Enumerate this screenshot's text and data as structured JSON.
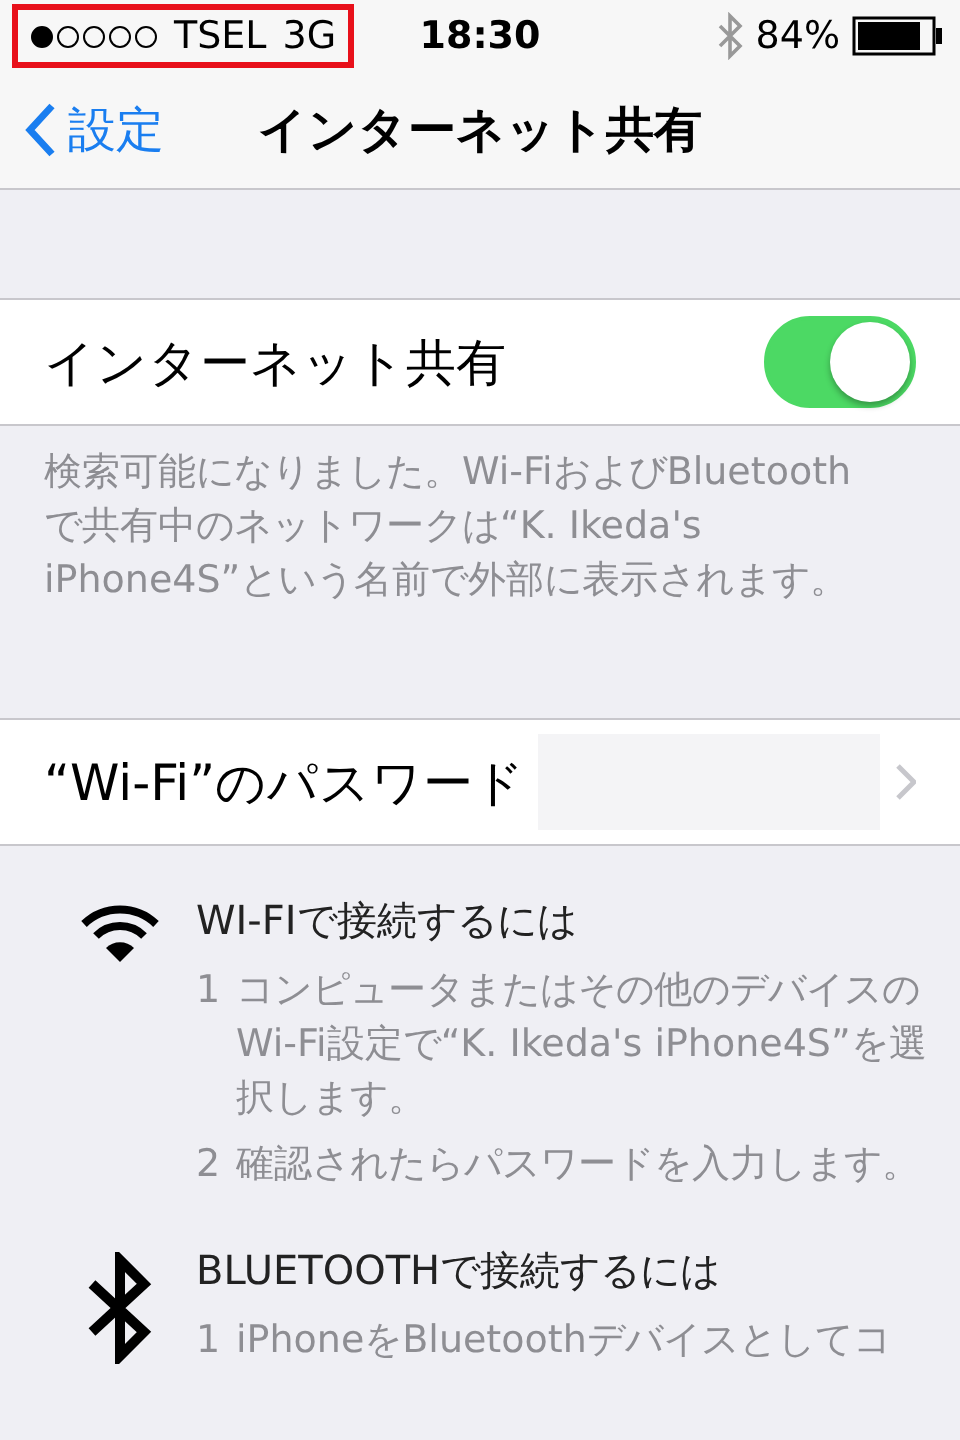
{
  "status_bar": {
    "carrier": "TSEL",
    "network": "3G",
    "carrier_highlighted": true,
    "time": "18:30",
    "battery": "84%"
  },
  "nav": {
    "back_label": "設定",
    "title": "インターネット共有"
  },
  "toggle_row": {
    "label": "インターネット共有",
    "on": true
  },
  "footer": "検索可能になりました。Wi-FiおよびBluetoothで共有中のネットワークは“K. Ikeda's iPhone4S”という名前で外部に表示されます。",
  "password_row": {
    "label": "“Wi-Fi”のパスワード"
  },
  "instructions": [
    {
      "kind": "wifi",
      "heading": "WI-FIで接続するには",
      "steps": [
        {
          "number": "1",
          "text": "コンピュータまたはその他のデバイスのWi-Fi設定で“K. Ikeda's iPhone4S”を選択します。"
        },
        {
          "number": "2",
          "text": "確認されたらパスワードを入力します。"
        }
      ]
    },
    {
      "kind": "bluetooth",
      "heading": "BLUETOOTHで接続するには",
      "steps": [
        {
          "number": "1",
          "text": "iPhoneをBluetoothデバイスとしてコ"
        }
      ]
    }
  ]
}
